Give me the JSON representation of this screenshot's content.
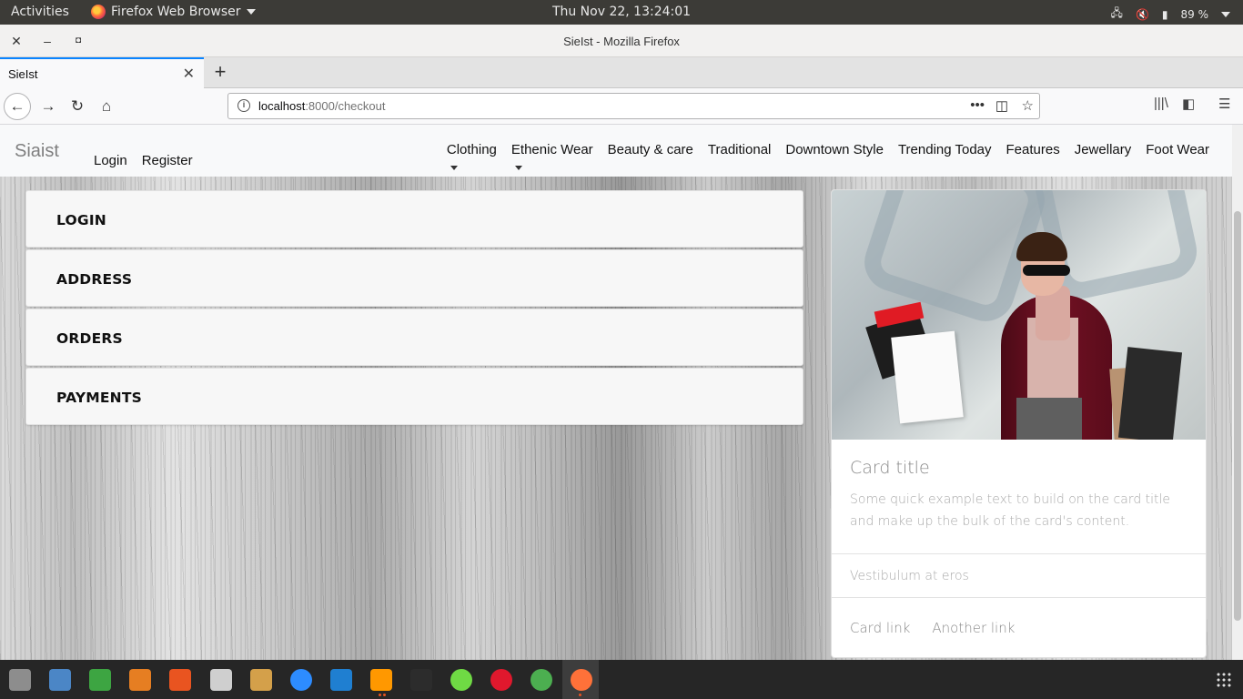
{
  "system": {
    "activities": "Activities",
    "app_menu": "Firefox Web Browser",
    "clock": "Thu Nov 22, 13:24:01",
    "battery": "89 %"
  },
  "window": {
    "title": "SieIst - Mozilla Firefox"
  },
  "tab": {
    "label": "SieIst"
  },
  "urlbar": {
    "host": "localhost",
    "path": ":8000/checkout"
  },
  "site": {
    "brand": "Siaist",
    "auth": [
      "Login",
      "Register"
    ],
    "menu": [
      "Clothing",
      "Ethenic Wear",
      "Beauty & care",
      "Traditional",
      "Downtown Style",
      "Trending Today",
      "Features",
      "Jewellary",
      "Foot Wear"
    ]
  },
  "accordion": [
    "LOGIN",
    "ADDRESS",
    "ORDERS",
    "PAYMENTS"
  ],
  "card": {
    "title": "Card title",
    "text": "Some quick example text to build on the card title and make up the bulk of the card's content.",
    "list_item": "Vestibulum at eros",
    "links": [
      "Card link",
      "Another link"
    ]
  },
  "dock": {
    "apps": [
      {
        "name": "files-icon",
        "color": "#8d8d8d"
      },
      {
        "name": "image-viewer-icon",
        "color": "#4b86c6"
      },
      {
        "name": "spreadsheet-icon",
        "color": "#3da542"
      },
      {
        "name": "presentation-icon",
        "color": "#e67e22"
      },
      {
        "name": "software-center-icon",
        "color": "#e95420"
      },
      {
        "name": "settings-tool-icon",
        "color": "#cfcfcf"
      },
      {
        "name": "lock-icon",
        "color": "#d4a04a"
      },
      {
        "name": "zoom-icon",
        "color": "#2d8cff"
      },
      {
        "name": "vscode-icon",
        "color": "#1f7fd1"
      },
      {
        "name": "sublime-icon",
        "color": "#ff9800"
      },
      {
        "name": "terminal-icon",
        "color": "#2c2c2c"
      },
      {
        "name": "upwork-icon",
        "color": "#6fda44"
      },
      {
        "name": "opera-icon",
        "color": "#e0182d"
      },
      {
        "name": "chrome-icon",
        "color": "#4caf50"
      },
      {
        "name": "firefox-icon",
        "color": "#ff7139"
      }
    ]
  }
}
